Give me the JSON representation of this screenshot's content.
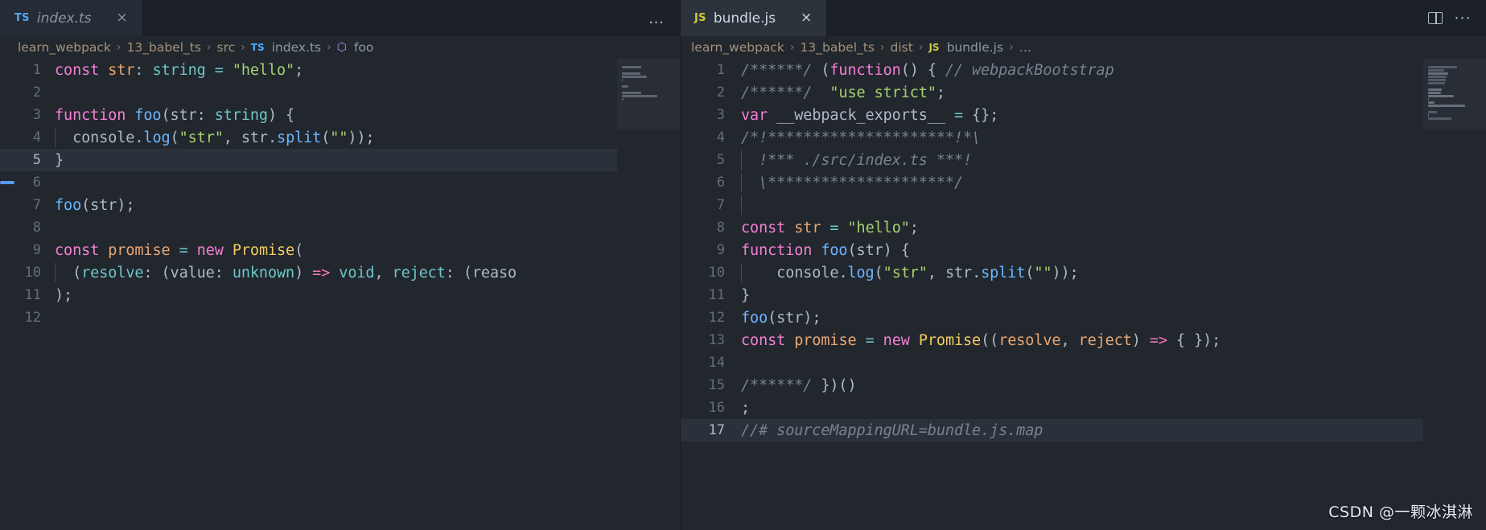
{
  "window": {
    "background": "#22272e",
    "accent": "#539bf5"
  },
  "left_group": {
    "tab": {
      "icon": "typescript-file-icon",
      "icon_label": "TS",
      "label": "index.ts",
      "close_label": "×",
      "state": "preview-inactive"
    },
    "overflow_label": "…",
    "breadcrumbs": [
      {
        "label": "learn_webpack",
        "kind": "folder"
      },
      {
        "label": "13_babel_ts",
        "kind": "folder"
      },
      {
        "label": "src",
        "kind": "folder"
      },
      {
        "label": "index.ts",
        "kind": "file",
        "badge": "TS"
      },
      {
        "label": "foo",
        "kind": "symbol",
        "badge": "⬡"
      }
    ],
    "separator": "›",
    "active_line": 5,
    "code": [
      {
        "n": 1,
        "tokens": [
          {
            "t": "const",
            "c": "kw"
          },
          {
            "t": " ",
            "c": "plain"
          },
          {
            "t": "str",
            "c": "var"
          },
          {
            "t": ": ",
            "c": "punc"
          },
          {
            "t": "string",
            "c": "type"
          },
          {
            "t": " = ",
            "c": "op"
          },
          {
            "t": "\"hello\"",
            "c": "str"
          },
          {
            "t": ";",
            "c": "punc"
          }
        ]
      },
      {
        "n": 2,
        "tokens": []
      },
      {
        "n": 3,
        "tokens": [
          {
            "t": "function",
            "c": "kw"
          },
          {
            "t": " ",
            "c": "plain"
          },
          {
            "t": "foo",
            "c": "fn"
          },
          {
            "t": "(",
            "c": "punc"
          },
          {
            "t": "str",
            "c": "plain"
          },
          {
            "t": ": ",
            "c": "punc"
          },
          {
            "t": "string",
            "c": "type"
          },
          {
            "t": ") {",
            "c": "punc"
          }
        ]
      },
      {
        "n": 4,
        "indent": 1,
        "tokens": [
          {
            "t": "  ",
            "c": "plain"
          },
          {
            "t": "console",
            "c": "plain"
          },
          {
            "t": ".",
            "c": "punc"
          },
          {
            "t": "log",
            "c": "fn"
          },
          {
            "t": "(",
            "c": "punc"
          },
          {
            "t": "\"str\"",
            "c": "str"
          },
          {
            "t": ", ",
            "c": "punc"
          },
          {
            "t": "str",
            "c": "plain"
          },
          {
            "t": ".",
            "c": "punc"
          },
          {
            "t": "split",
            "c": "fn"
          },
          {
            "t": "(",
            "c": "punc"
          },
          {
            "t": "\"\"",
            "c": "str"
          },
          {
            "t": "));",
            "c": "punc"
          }
        ]
      },
      {
        "n": 5,
        "tokens": [
          {
            "t": "}",
            "c": "punc"
          }
        ]
      },
      {
        "n": 6,
        "tokens": []
      },
      {
        "n": 7,
        "tokens": [
          {
            "t": "foo",
            "c": "fn"
          },
          {
            "t": "(",
            "c": "punc"
          },
          {
            "t": "str",
            "c": "plain"
          },
          {
            "t": ");",
            "c": "punc"
          }
        ]
      },
      {
        "n": 8,
        "tokens": []
      },
      {
        "n": 9,
        "tokens": [
          {
            "t": "const",
            "c": "kw"
          },
          {
            "t": " ",
            "c": "plain"
          },
          {
            "t": "promise",
            "c": "var"
          },
          {
            "t": " = ",
            "c": "op"
          },
          {
            "t": "new",
            "c": "kw"
          },
          {
            "t": " ",
            "c": "plain"
          },
          {
            "t": "Promise",
            "c": "cls"
          },
          {
            "t": "(",
            "c": "punc"
          }
        ]
      },
      {
        "n": 10,
        "indent": 1,
        "tokens": [
          {
            "t": "  (",
            "c": "punc"
          },
          {
            "t": "resolve",
            "c": "type"
          },
          {
            "t": ": (",
            "c": "punc"
          },
          {
            "t": "value",
            "c": "plain"
          },
          {
            "t": ": ",
            "c": "punc"
          },
          {
            "t": "unknown",
            "c": "type"
          },
          {
            "t": ") ",
            "c": "punc"
          },
          {
            "t": "=>",
            "c": "kw2"
          },
          {
            "t": " ",
            "c": "plain"
          },
          {
            "t": "void",
            "c": "type"
          },
          {
            "t": ", ",
            "c": "punc"
          },
          {
            "t": "reject",
            "c": "type"
          },
          {
            "t": ": (",
            "c": "punc"
          },
          {
            "t": "reaso",
            "c": "plain"
          }
        ]
      },
      {
        "n": 11,
        "tokens": [
          {
            "t": ");",
            "c": "punc"
          }
        ]
      },
      {
        "n": 12,
        "tokens": []
      }
    ]
  },
  "right_group": {
    "tab": {
      "icon": "javascript-file-icon",
      "icon_label": "JS",
      "label": "bundle.js",
      "close_label": "×",
      "state": "active"
    },
    "actions": [
      {
        "name": "split-editor-right",
        "label": "⬚"
      },
      {
        "name": "more-actions",
        "label": "···"
      }
    ],
    "breadcrumbs": [
      {
        "label": "learn_webpack",
        "kind": "folder"
      },
      {
        "label": "13_babel_ts",
        "kind": "folder"
      },
      {
        "label": "dist",
        "kind": "folder"
      },
      {
        "label": "bundle.js",
        "kind": "file",
        "badge": "JS"
      },
      {
        "label": "…",
        "kind": "symbol"
      }
    ],
    "separator": "›",
    "active_line": 17,
    "code": [
      {
        "n": 1,
        "tokens": [
          {
            "t": "/******/ ",
            "c": "cmt"
          },
          {
            "t": "(",
            "c": "punc"
          },
          {
            "t": "function",
            "c": "kw"
          },
          {
            "t": "() { ",
            "c": "punc"
          },
          {
            "t": "// webpackBootstrap",
            "c": "cmt"
          }
        ]
      },
      {
        "n": 2,
        "tokens": [
          {
            "t": "/******/ ",
            "c": "cmt"
          },
          {
            "t": " ",
            "c": "plain"
          },
          {
            "t": "\"use strict\"",
            "c": "str"
          },
          {
            "t": ";",
            "c": "punc"
          }
        ]
      },
      {
        "n": 3,
        "tokens": [
          {
            "t": "var",
            "c": "kw"
          },
          {
            "t": " __webpack_exports__ ",
            "c": "plain"
          },
          {
            "t": "=",
            "c": "op"
          },
          {
            "t": " {};",
            "c": "punc"
          }
        ]
      },
      {
        "n": 4,
        "tokens": [
          {
            "t": "/*!*********************!*\\",
            "c": "cmt"
          }
        ]
      },
      {
        "n": 5,
        "indent": 1,
        "tokens": [
          {
            "t": "  !*** ./src/index.ts ***!",
            "c": "cmt"
          }
        ]
      },
      {
        "n": 6,
        "indent": 1,
        "tokens": [
          {
            "t": "  \\*********************/",
            "c": "cmt"
          }
        ]
      },
      {
        "n": 7,
        "indent": 1,
        "tokens": []
      },
      {
        "n": 8,
        "tokens": [
          {
            "t": "const",
            "c": "kw"
          },
          {
            "t": " ",
            "c": "plain"
          },
          {
            "t": "str",
            "c": "var"
          },
          {
            "t": " = ",
            "c": "op"
          },
          {
            "t": "\"hello\"",
            "c": "str"
          },
          {
            "t": ";",
            "c": "punc"
          }
        ]
      },
      {
        "n": 9,
        "tokens": [
          {
            "t": "function",
            "c": "kw"
          },
          {
            "t": " ",
            "c": "plain"
          },
          {
            "t": "foo",
            "c": "fn"
          },
          {
            "t": "(",
            "c": "punc"
          },
          {
            "t": "str",
            "c": "plain"
          },
          {
            "t": ") {",
            "c": "punc"
          }
        ]
      },
      {
        "n": 10,
        "indent": 1,
        "tokens": [
          {
            "t": "    ",
            "c": "plain"
          },
          {
            "t": "console",
            "c": "plain"
          },
          {
            "t": ".",
            "c": "punc"
          },
          {
            "t": "log",
            "c": "fn"
          },
          {
            "t": "(",
            "c": "punc"
          },
          {
            "t": "\"str\"",
            "c": "str"
          },
          {
            "t": ", ",
            "c": "punc"
          },
          {
            "t": "str",
            "c": "plain"
          },
          {
            "t": ".",
            "c": "punc"
          },
          {
            "t": "split",
            "c": "fn"
          },
          {
            "t": "(",
            "c": "punc"
          },
          {
            "t": "\"\"",
            "c": "str"
          },
          {
            "t": "));",
            "c": "punc"
          }
        ]
      },
      {
        "n": 11,
        "tokens": [
          {
            "t": "}",
            "c": "punc"
          }
        ]
      },
      {
        "n": 12,
        "tokens": [
          {
            "t": "foo",
            "c": "fn"
          },
          {
            "t": "(",
            "c": "punc"
          },
          {
            "t": "str",
            "c": "plain"
          },
          {
            "t": ");",
            "c": "punc"
          }
        ]
      },
      {
        "n": 13,
        "tokens": [
          {
            "t": "const",
            "c": "kw"
          },
          {
            "t": " ",
            "c": "plain"
          },
          {
            "t": "promise",
            "c": "var"
          },
          {
            "t": " = ",
            "c": "op"
          },
          {
            "t": "new",
            "c": "kw"
          },
          {
            "t": " ",
            "c": "plain"
          },
          {
            "t": "Promise",
            "c": "cls"
          },
          {
            "t": "((",
            "c": "punc"
          },
          {
            "t": "resolve",
            "c": "var"
          },
          {
            "t": ", ",
            "c": "punc"
          },
          {
            "t": "reject",
            "c": "var"
          },
          {
            "t": ") ",
            "c": "punc"
          },
          {
            "t": "=>",
            "c": "kw2"
          },
          {
            "t": " { });",
            "c": "punc"
          }
        ]
      },
      {
        "n": 14,
        "tokens": []
      },
      {
        "n": 15,
        "tokens": [
          {
            "t": "/******/ ",
            "c": "cmt"
          },
          {
            "t": "})()",
            "c": "punc"
          }
        ]
      },
      {
        "n": 16,
        "tokens": [
          {
            "t": ";",
            "c": "punc"
          }
        ]
      },
      {
        "n": 17,
        "tokens": [
          {
            "t": "//# sourceMappingURL=bundle.js.map",
            "c": "cmt"
          }
        ]
      }
    ]
  },
  "watermark": {
    "text": "CSDN @一颗冰淇淋"
  }
}
